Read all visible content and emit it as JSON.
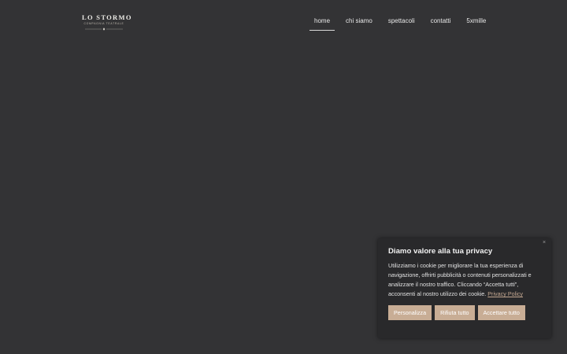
{
  "header": {
    "logo": {
      "name": "LO STORMO",
      "tagline": "COMPAGNIA TEATRALE"
    },
    "nav": [
      {
        "label": "home",
        "active": true
      },
      {
        "label": "chi siamo",
        "active": false
      },
      {
        "label": "spettacoli",
        "active": false
      },
      {
        "label": "contatti",
        "active": false
      },
      {
        "label": "5xmille",
        "active": false
      }
    ]
  },
  "cookie_banner": {
    "close_icon": "×",
    "title": "Diamo valore alla tua privacy",
    "text": "Utilizziamo i cookie per migliorare la tua esperienza di navigazione, offrirti pubblicità o contenuti personalizzati e analizzare il nostro traffico. Cliccando “Accetta tutti”, acconsenti al nostro utilizzo dei cookie.",
    "link_label": "Privacy Policy",
    "buttons": {
      "customize": "Personalizza",
      "reject": "Rifiuta tutto",
      "accept": "Accettare tutto"
    }
  },
  "colors": {
    "background": "#333335",
    "banner_background": "#29292b",
    "accent": "#c8ad95",
    "link": "#c4a891"
  }
}
